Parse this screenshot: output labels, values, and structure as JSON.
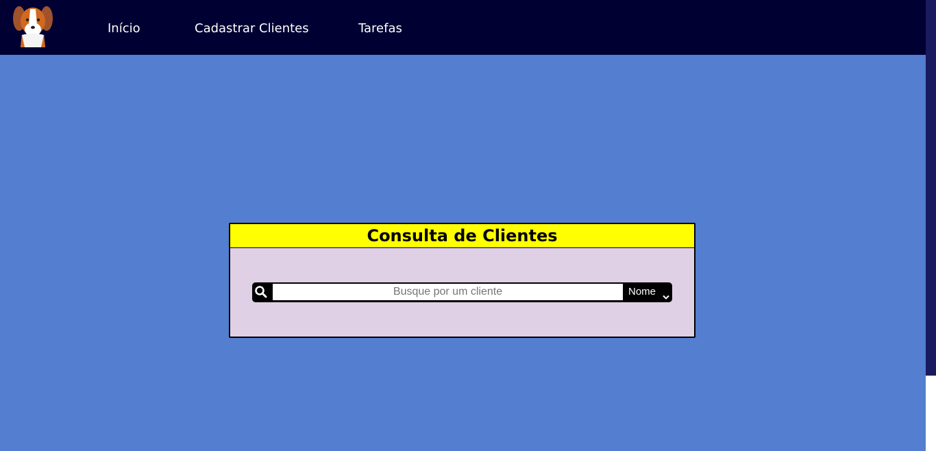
{
  "nav": {
    "logo_icon": "dog-logo-icon",
    "items": [
      {
        "label": "Início"
      },
      {
        "label": "Cadastrar Clientes"
      },
      {
        "label": "Tarefas"
      }
    ]
  },
  "card": {
    "title": "Consulta de Clientes",
    "search": {
      "icon": "search-icon",
      "placeholder": "Busque por um cliente",
      "value": "",
      "filter_selected": "Nome"
    }
  },
  "colors": {
    "navbar": "#000033",
    "background": "#547ecf",
    "card_header": "#ffff00",
    "card_body": "#dfd0e6"
  }
}
